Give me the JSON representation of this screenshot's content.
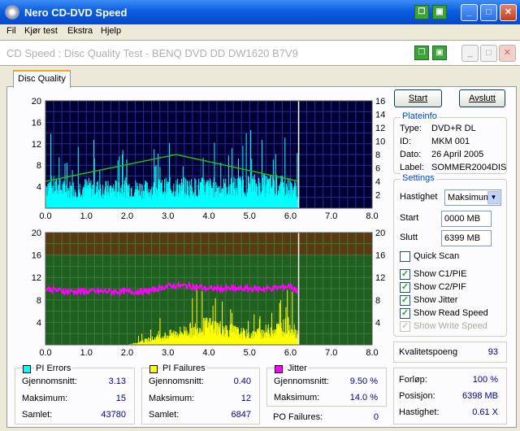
{
  "window": {
    "title": "Nero CD-DVD Speed",
    "subtitle": "CD Speed : Disc Quality Test - BENQ     DVD DD DW1620     B7V9"
  },
  "menu": [
    "Fil",
    "Kjør test",
    "Ekstra",
    "Hjelp"
  ],
  "tab": {
    "label": "Disc Quality"
  },
  "buttons": {
    "start": "Start",
    "exit": "Avslutt"
  },
  "plateinfo": {
    "legend": "Plateinfo",
    "rows": [
      {
        "label": "Type:",
        "value": "DVD+R DL"
      },
      {
        "label": "ID:",
        "value": "MKM 001"
      },
      {
        "label": "Dato:",
        "value": "26 April 2005"
      },
      {
        "label": "Label:",
        "value": "SOMMER2004DIS"
      }
    ]
  },
  "settings": {
    "legend": "Settings",
    "speed_label": "Hastighet",
    "speed_value": "Maksimum",
    "start_label": "Start",
    "start_value": "0000 MB",
    "end_label": "Slutt",
    "end_value": "6399 MB",
    "checks": [
      {
        "label": "Quick Scan",
        "checked": false,
        "enabled": true
      },
      {
        "label": "Show C1/PIE",
        "checked": true,
        "enabled": true
      },
      {
        "label": "Show C2/PIF",
        "checked": true,
        "enabled": true
      },
      {
        "label": "Show Jitter",
        "checked": true,
        "enabled": true
      },
      {
        "label": "Show Read Speed",
        "checked": true,
        "enabled": true
      },
      {
        "label": "Show Write Speed",
        "checked": true,
        "enabled": false
      }
    ]
  },
  "quality": {
    "label": "Kvalitetspoeng",
    "value": "93"
  },
  "progress": {
    "rows": [
      {
        "label": "Forløp:",
        "value": "100 %"
      },
      {
        "label": "Posisjon:",
        "value": "6398 MB"
      },
      {
        "label": "Hastighet:",
        "value": "0.61 X"
      }
    ]
  },
  "stats": {
    "pie": {
      "title": "PI Errors",
      "color": "#00ffff",
      "rows": [
        {
          "label": "Gjennomsnitt:",
          "value": "3.13"
        },
        {
          "label": "Maksimum:",
          "value": "15"
        },
        {
          "label": "Samlet:",
          "value": "43780"
        }
      ]
    },
    "pif": {
      "title": "PI Failures",
      "color": "#ffff00",
      "rows": [
        {
          "label": "Gjennomsnitt:",
          "value": "0.40"
        },
        {
          "label": "Maksimum:",
          "value": "12"
        },
        {
          "label": "Samlet:",
          "value": "6847"
        }
      ]
    },
    "jitter": {
      "title": "Jitter",
      "color": "#ff00ff",
      "rows": [
        {
          "label": "Gjennomsnitt:",
          "value": "9.50 %"
        },
        {
          "label": "Maksimum:",
          "value": "14.0 %"
        }
      ]
    },
    "po_failures": {
      "label": "PO Failures:",
      "value": "0"
    }
  },
  "colors": {
    "top_bg": "#000033",
    "bottom_bg_top": "#5a3a10",
    "bottom_bg": "#1f5f1f",
    "grid": "#2a2a9a",
    "pie": "#00ffff",
    "pif": "#ffff00",
    "jitter": "#ff00ff",
    "speed": "#22bb22"
  },
  "chart_data": [
    {
      "type": "bar",
      "title": "PI Errors / Read speed",
      "xlim": [
        0,
        8
      ],
      "ylim_left": [
        0,
        20
      ],
      "ylim_right": [
        0,
        16
      ],
      "x_ticks": [
        "0.0",
        "1.0",
        "2.0",
        "3.0",
        "4.0",
        "5.0",
        "6.0",
        "7.0",
        "8.0"
      ],
      "y_ticks_left": [
        "20",
        "16",
        "12",
        "8",
        "4"
      ],
      "y_ticks_right": [
        "16",
        "14",
        "12",
        "10",
        "8",
        "6",
        "4",
        "2"
      ],
      "end_marker": 6.2,
      "series": [
        {
          "name": "PI Errors",
          "x": [
            0.0,
            0.5,
            1.0,
            1.5,
            2.0,
            2.5,
            3.0,
            3.5,
            4.0,
            4.5,
            5.0,
            5.5,
            6.0,
            6.2
          ],
          "values": [
            5,
            4,
            4.5,
            4,
            4.5,
            4,
            4.5,
            4.5,
            4.5,
            4.5,
            5,
            5,
            4.5,
            4
          ]
        },
        {
          "name": "Read Speed",
          "x": [
            0.0,
            3.2,
            6.2
          ],
          "values": [
            4,
            8,
            4
          ]
        }
      ]
    },
    {
      "type": "bar",
      "title": "PI Failures / Jitter",
      "xlim": [
        0,
        8
      ],
      "ylim_left": [
        0,
        20
      ],
      "ylim_right": [
        0,
        20
      ],
      "x_ticks": [
        "0.0",
        "1.0",
        "2.0",
        "3.0",
        "4.0",
        "5.0",
        "6.0",
        "7.0",
        "8.0"
      ],
      "y_ticks_left": [
        "20",
        "16",
        "12",
        "8",
        "4"
      ],
      "y_ticks_right": [
        "20",
        "16",
        "12",
        "8",
        "4"
      ],
      "end_marker": 6.2,
      "series": [
        {
          "name": "PI Failures",
          "x": [
            0.0,
            1.0,
            2.0,
            3.0,
            3.5,
            4.0,
            4.5,
            5.0,
            5.5,
            6.0,
            6.2
          ],
          "values": [
            0,
            0,
            0,
            2,
            3,
            4,
            3,
            2,
            3,
            4,
            2
          ]
        },
        {
          "name": "Jitter",
          "x": [
            0.0,
            0.5,
            1.0,
            1.5,
            2.0,
            2.5,
            3.0,
            3.5,
            4.0,
            4.5,
            5.0,
            5.5,
            6.0,
            6.2
          ],
          "values": [
            10,
            9.5,
            9.5,
            9.5,
            9.5,
            9.5,
            10.5,
            10.5,
            10,
            10,
            10,
            10,
            10.5,
            9.5
          ]
        }
      ]
    }
  ]
}
